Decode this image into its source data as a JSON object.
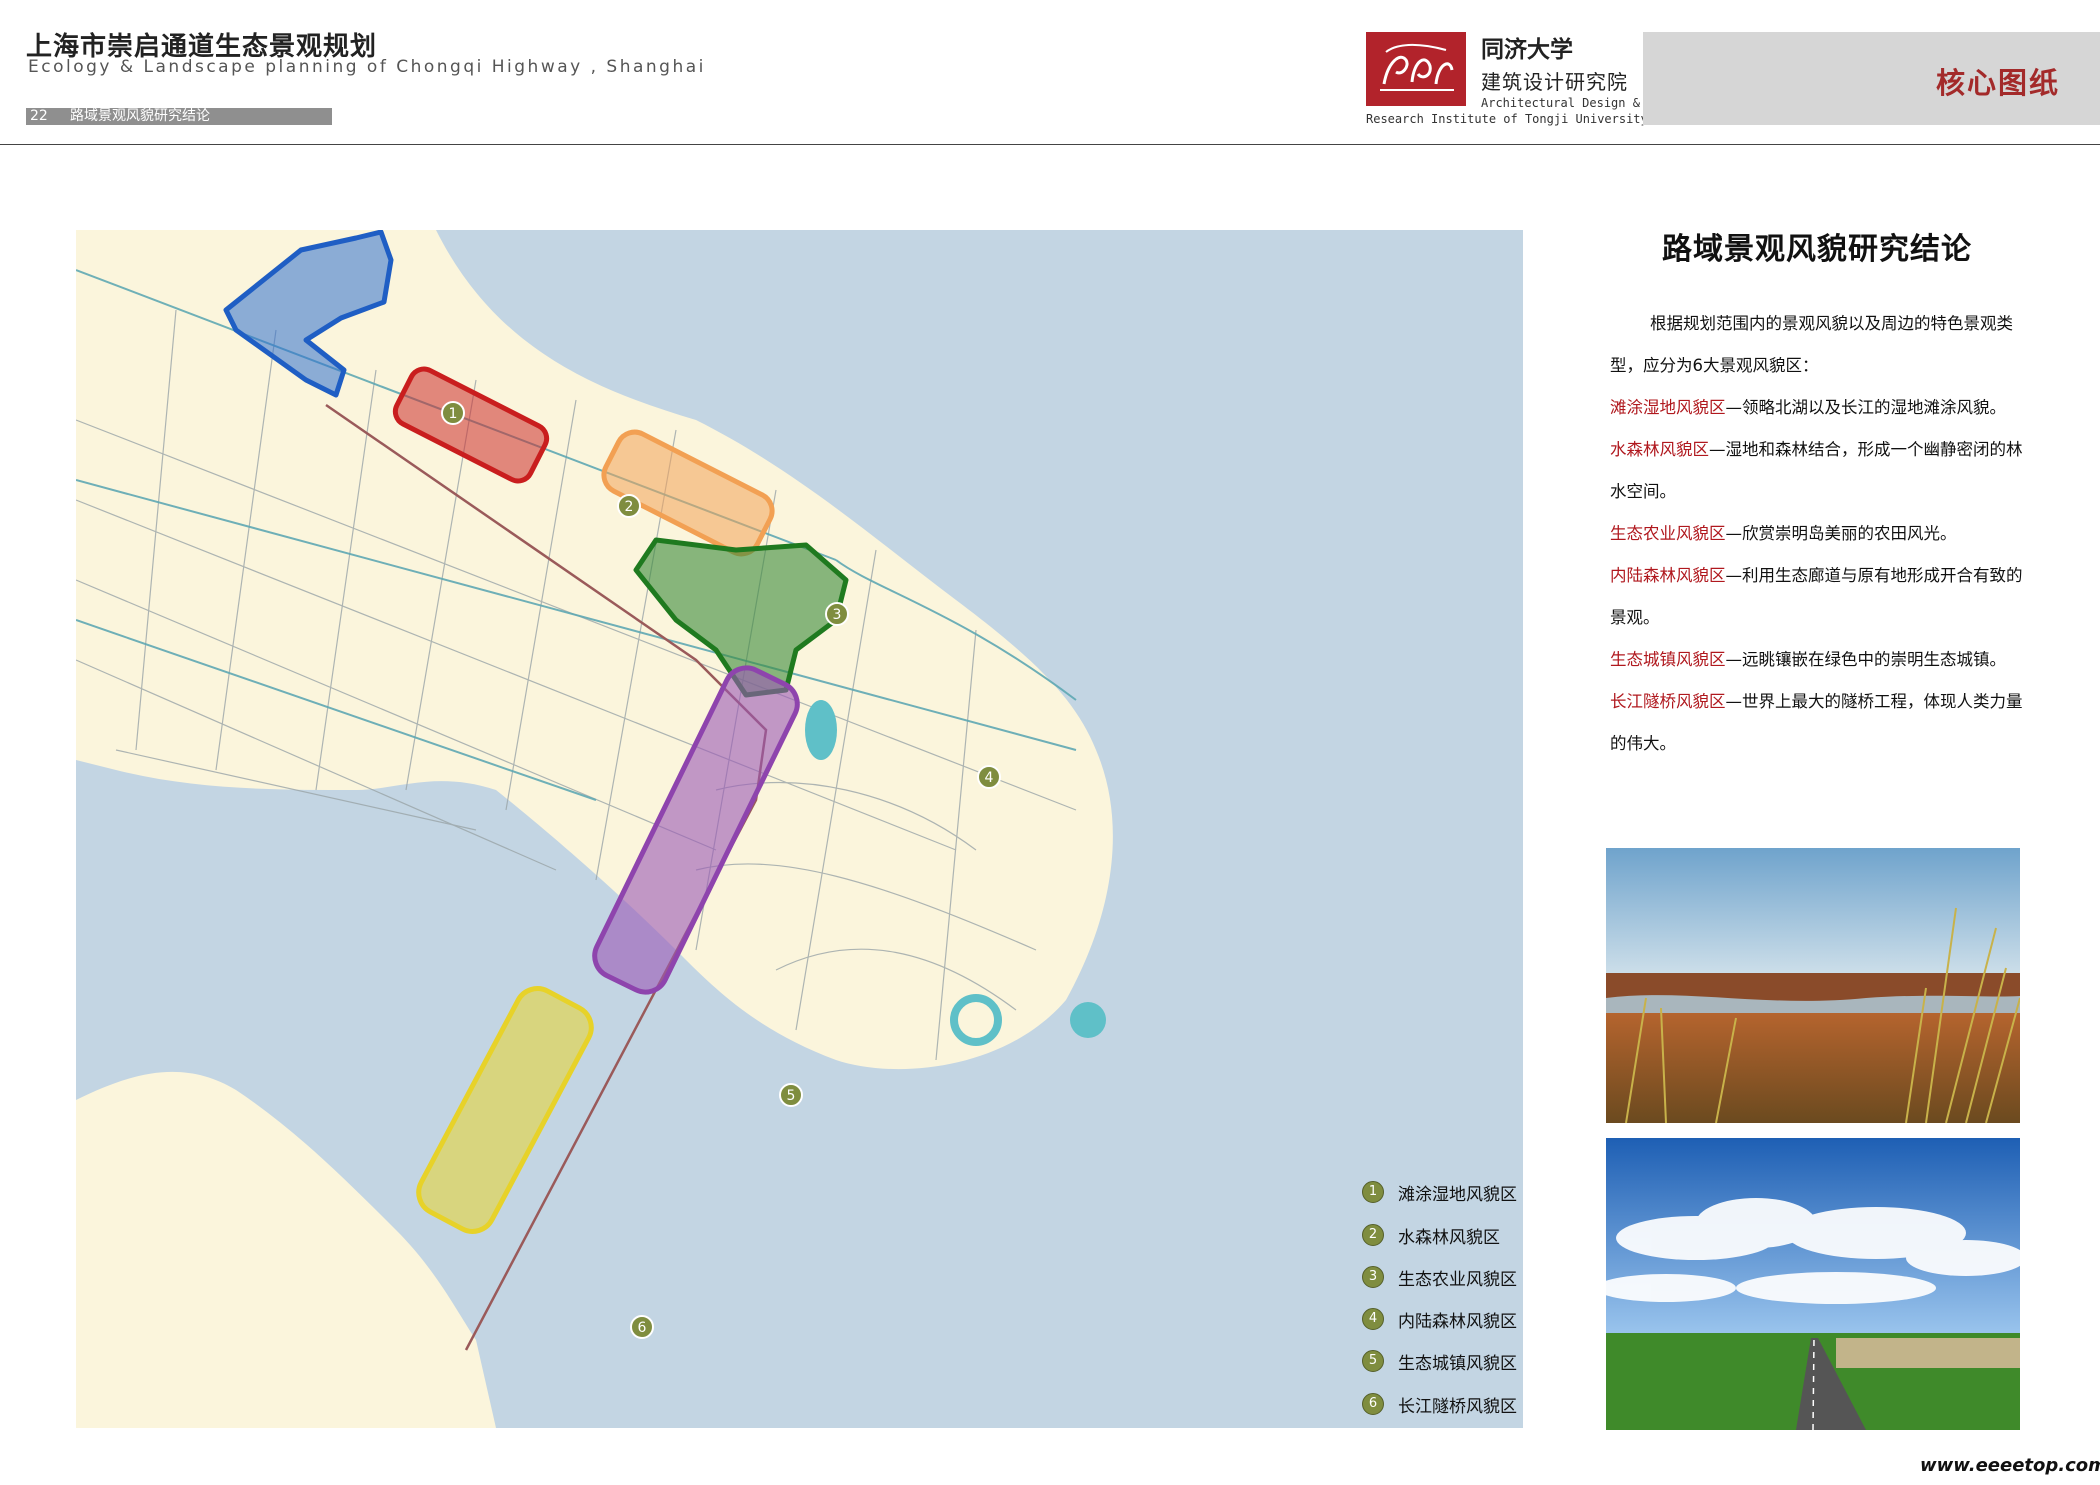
{
  "header": {
    "title": "上海市崇启通道生态景观规划",
    "subtitle": "Ecology & Landscape planning of Chongqi Highway , Shanghai",
    "page_number": "22",
    "page_section": "路域景观风貌研究结论",
    "university": "同济大学",
    "institute": "建筑设计研究院",
    "institute_en_line1": "Architectural Design &",
    "institute_en_line2": "Research Institute of Tongji University",
    "core_label": "核心图纸"
  },
  "colors": {
    "water": "#c3d5e3",
    "land": "#fbf5dc",
    "zone1": "#2f6fd0",
    "zone2": "#cc2b2b",
    "zone3": "#f3a35a",
    "zone4": "#3a8a3a",
    "zone5": "#9b59b6",
    "zone6": "#e6d63a",
    "legend_marker": "#7f8d3f",
    "zone_text": "#b0181e"
  },
  "map": {
    "markers": [
      "1",
      "2",
      "3",
      "4",
      "5",
      "6"
    ]
  },
  "legend": [
    {
      "num": "1",
      "label": "滩涂湿地风貌区"
    },
    {
      "num": "2",
      "label": "水森林风貌区"
    },
    {
      "num": "3",
      "label": "生态农业风貌区"
    },
    {
      "num": "4",
      "label": "内陆森林风貌区"
    },
    {
      "num": "5",
      "label": "生态城镇风貌区"
    },
    {
      "num": "6",
      "label": "长江隧桥风貌区"
    }
  ],
  "text": {
    "title": "路域景观风貌研究结论",
    "intro": "根据规划范围内的景观风貌以及周边的特色景观类型，应分为6大景观风貌区：",
    "zones": [
      {
        "name": "滩涂湿地风貌区",
        "desc": "—领略北湖以及长江的湿地滩涂风貌。"
      },
      {
        "name": "水森林风貌区",
        "desc": "—湿地和森林结合，形成一个幽静密闭的林水空间。"
      },
      {
        "name": "生态农业风貌区",
        "desc": "—欣赏崇明岛美丽的农田风光。"
      },
      {
        "name": "内陆森林风貌区",
        "desc": "—利用生态廊道与原有地形成开合有致的景观。"
      },
      {
        "name": "生态城镇风貌区",
        "desc": "—远眺镶嵌在绿色中的崇明生态城镇。"
      },
      {
        "name": "长江隧桥风貌区",
        "desc": "—世界上最大的隧桥工程，体现人类力量的伟大。"
      }
    ]
  },
  "footer": {
    "website": "www.eeeetop.com"
  }
}
